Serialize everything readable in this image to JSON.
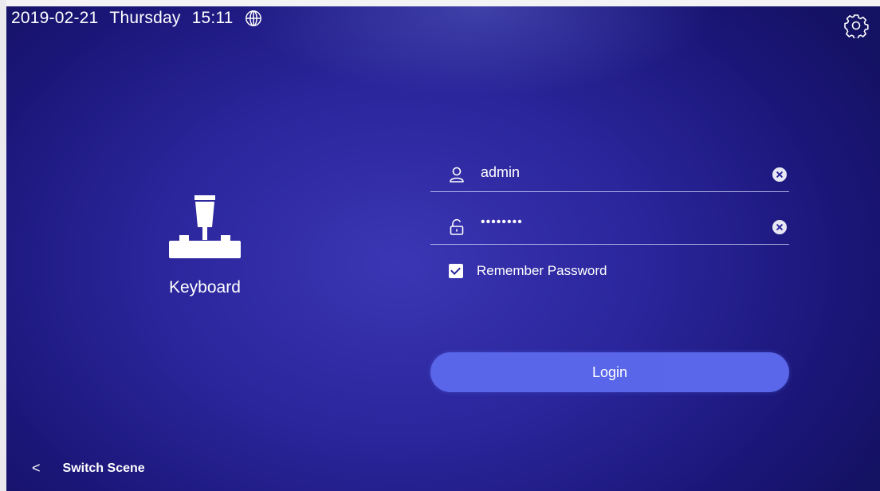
{
  "status": {
    "date": "2019-02-21",
    "weekday": "Thursday",
    "time": "15:11",
    "language_icon": "globe-icon"
  },
  "settings_icon": "gear-icon",
  "scene": {
    "icon": "joystick-keyboard-icon",
    "label": "Keyboard"
  },
  "login_form": {
    "username": {
      "icon": "user-icon",
      "value": "admin"
    },
    "password": {
      "icon": "lock-icon",
      "value": "••••••••"
    },
    "remember_label": "Remember Password",
    "remember_checked": true,
    "login_label": "Login"
  },
  "footer": {
    "chevron": "<",
    "switch_scene_label": "Switch Scene"
  },
  "colors": {
    "background": "#2a259a",
    "button": "#5a66ea"
  }
}
